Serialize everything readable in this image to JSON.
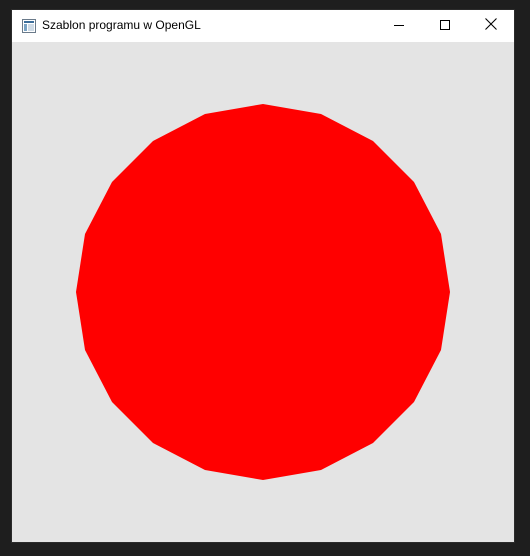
{
  "window": {
    "title": "Szablon programu w OpenGL",
    "app_icon": "opengl-window-icon",
    "controls": {
      "minimize_icon": "minimize-icon",
      "maximize_icon": "maximize-icon",
      "close_icon": "close-icon"
    }
  },
  "canvas": {
    "background_color": "#e4e4e4",
    "shape": {
      "type": "regular-polygon",
      "sides": 20,
      "fill_color": "#ff0000"
    }
  }
}
